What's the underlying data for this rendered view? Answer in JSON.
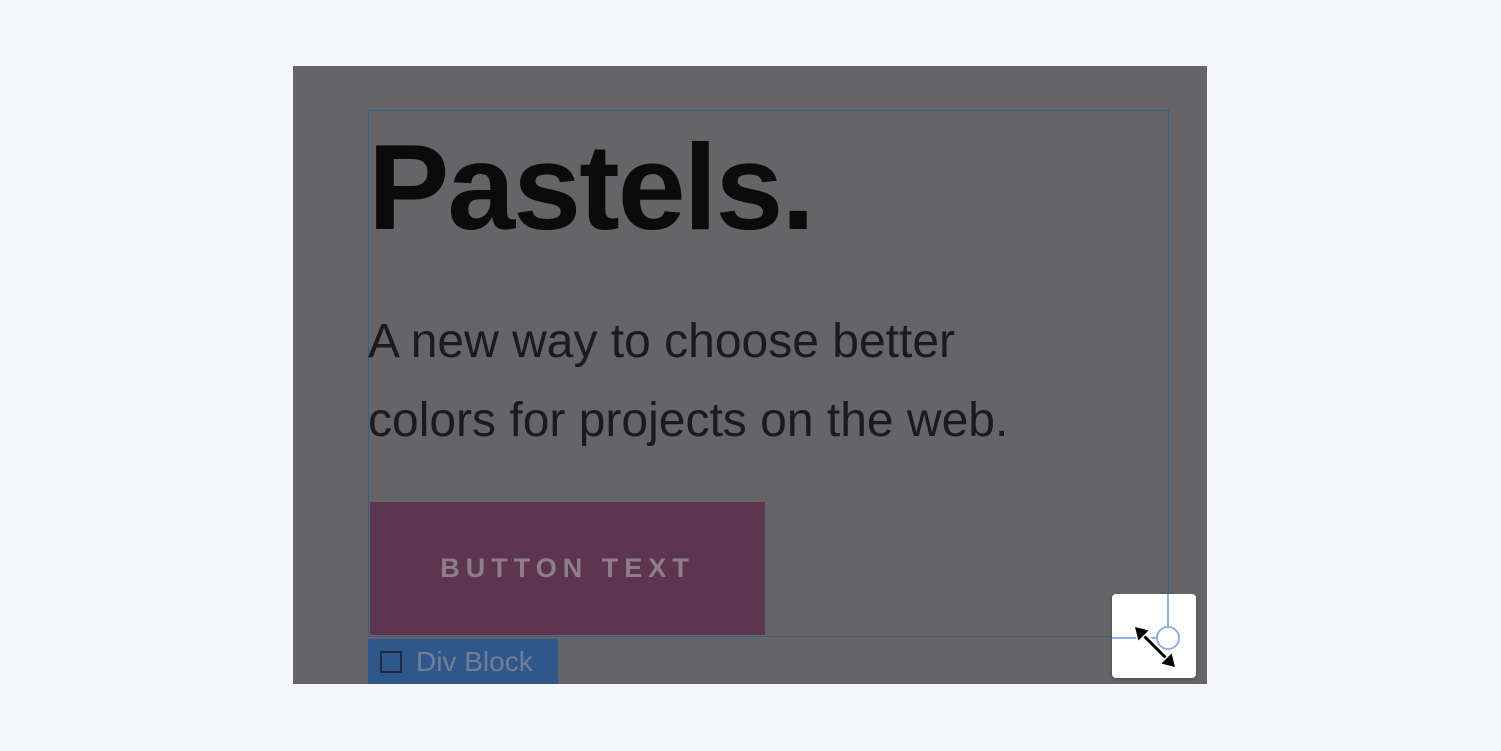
{
  "canvas": {
    "heading": "Pastels.",
    "subheading_line1": "A new way to choose better",
    "subheading_line2": "colors for projects on the web.",
    "button_label": "BUTTON TEXT"
  },
  "selection": {
    "element_label": "Div Block",
    "element_icon": "square-box-icon",
    "handle_icon": "resize-handle-icon",
    "cursor_icon": "diagonal-resize-cursor-icon"
  },
  "colors": {
    "overlay": "#656466",
    "selection_outline": "#3b5c86",
    "tag_background": "#2f578a",
    "button_background": "#5e3551",
    "handle_line": "#8fb0e6"
  }
}
